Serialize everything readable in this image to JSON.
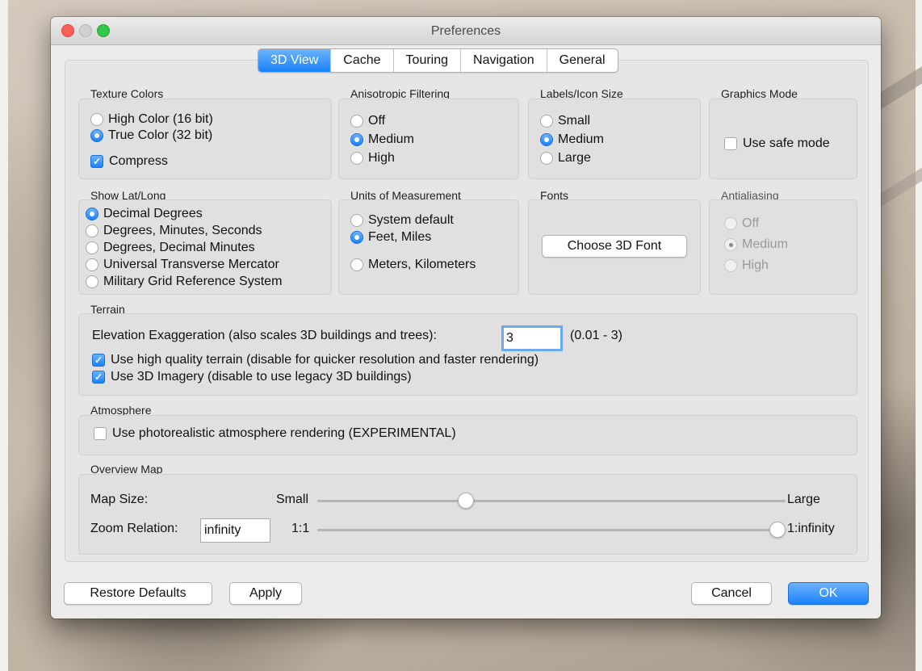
{
  "window": {
    "title": "Preferences"
  },
  "tabs": [
    "3D View",
    "Cache",
    "Touring",
    "Navigation",
    "General"
  ],
  "texture_colors": {
    "label": "Texture Colors",
    "options": [
      "High Color (16 bit)",
      "True Color (32 bit)"
    ],
    "selected": "True Color (32 bit)",
    "compress_label": "Compress",
    "compress_checked": true
  },
  "anisotropic": {
    "label": "Anisotropic Filtering",
    "options": [
      "Off",
      "Medium",
      "High"
    ],
    "selected": "Medium"
  },
  "labels_icon_size": {
    "label": "Labels/Icon Size",
    "options": [
      "Small",
      "Medium",
      "Large"
    ],
    "selected": "Medium"
  },
  "graphics_mode": {
    "label": "Graphics Mode",
    "safe_mode_label": "Use safe mode",
    "safe_mode_checked": false
  },
  "show_lat_long": {
    "label": "Show Lat/Long",
    "options": [
      "Decimal Degrees",
      "Degrees, Minutes, Seconds",
      "Degrees, Decimal Minutes",
      "Universal Transverse Mercator",
      "Military Grid Reference System"
    ],
    "selected": "Decimal Degrees"
  },
  "units": {
    "label": "Units of Measurement",
    "options": [
      "System default",
      "Feet, Miles",
      "Meters, Kilometers"
    ],
    "selected": "Feet, Miles"
  },
  "fonts": {
    "label": "Fonts",
    "button_label": "Choose 3D Font"
  },
  "antialiasing": {
    "label": "Antialiasing",
    "options": [
      "Off",
      "Medium",
      "High"
    ],
    "selected": "Medium",
    "disabled": true
  },
  "terrain": {
    "label": "Terrain",
    "elevation_label": "Elevation Exaggeration (also scales 3D buildings and trees):",
    "elevation_value": "3",
    "elevation_range": "(0.01 - 3)",
    "high_quality_label": "Use high quality terrain (disable for quicker resolution and faster rendering)",
    "high_quality_checked": true,
    "imagery_label": "Use 3D Imagery (disable to use legacy 3D buildings)",
    "imagery_checked": true
  },
  "atmosphere": {
    "label": "Atmosphere",
    "photoreal_label": "Use photorealistic atmosphere rendering (EXPERIMENTAL)",
    "photoreal_checked": false
  },
  "overview_map": {
    "label": "Overview Map",
    "map_size_label": "Map Size:",
    "map_size_min": "Small",
    "map_size_max": "Large",
    "map_size_value": 0.31,
    "zoom_label": "Zoom Relation:",
    "zoom_value": "infinity",
    "zoom_min": "1:1",
    "zoom_max": "1:infinity",
    "zoom_slider_value": 1.0
  },
  "buttons": {
    "restore": "Restore Defaults",
    "apply": "Apply",
    "cancel": "Cancel",
    "ok": "OK"
  }
}
